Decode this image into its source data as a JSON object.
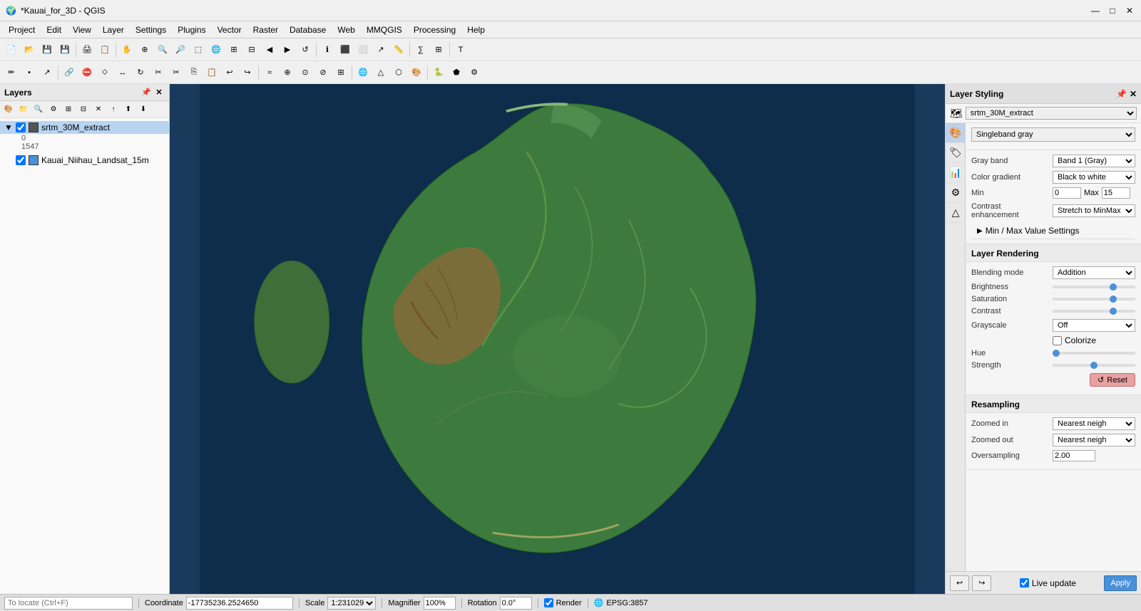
{
  "titlebar": {
    "title": "*Kauai_for_3D - QGIS",
    "icon": "🌍",
    "buttons": [
      "—",
      "□",
      "✕"
    ]
  },
  "menubar": {
    "items": [
      "Project",
      "Edit",
      "View",
      "Layer",
      "Settings",
      "Plugins",
      "Vector",
      "Raster",
      "Database",
      "Web",
      "MMQGIS",
      "Processing",
      "Help"
    ]
  },
  "layers_panel": {
    "title": "Layers",
    "layers": [
      {
        "id": "srtm_30M_extract",
        "label": "srtm_30M_extract",
        "checked": true,
        "active": true,
        "sub_items": [
          "0",
          "1547"
        ]
      },
      {
        "id": "kauai_niihau_landsat",
        "label": "Kauai_Niihau_Landsat_15m",
        "checked": true,
        "active": false
      }
    ]
  },
  "styling_panel": {
    "title": "Layer Styling",
    "layer_name": "srtm_30M_extract",
    "render_type": "Singleband gray",
    "gray_band": "Band 1 (Gray)",
    "color_gradient": "Black to white",
    "min_value": "0",
    "max_value": "15",
    "contrast_enhancement": "Stretch to MinMax",
    "min_max_section": "Min / Max Value Settings",
    "layer_rendering": "Layer Rendering",
    "blending_mode": "Addition",
    "brightness_label": "Brightness",
    "brightness_value": 75,
    "saturation_label": "Saturation",
    "saturation_value": 75,
    "contrast_label": "Contrast",
    "contrast_value": 75,
    "grayscale_label": "Grayscale",
    "grayscale_value": "Off",
    "colorize_label": "Colorize",
    "colorize_checked": false,
    "hue_label": "Hue",
    "strength_label": "Strength",
    "strength_value": 50,
    "reset_label": "Reset",
    "resampling_label": "Resampling",
    "zoomed_in_label": "Zoomed in",
    "zoomed_in_value": "Nearest neigh",
    "zoomed_out_label": "Zoomed out",
    "zoomed_out_value": "Nearest neigh",
    "oversampling_label": "Oversampling",
    "oversampling_value": "2.00",
    "live_update_label": "Live update",
    "apply_label": "Apply"
  },
  "statusbar": {
    "search_placeholder": "To locate (Ctrl+F)",
    "coordinate_label": "Coordinate",
    "coordinate_value": "-17735236.2524650",
    "scale_label": "Scale",
    "scale_value": "1:231029",
    "magnifier_label": "Magnifier",
    "magnifier_value": "100%",
    "rotation_label": "Rotation",
    "rotation_value": "0.0°",
    "render_label": "Render",
    "epsg_value": "EPSG:3857"
  }
}
